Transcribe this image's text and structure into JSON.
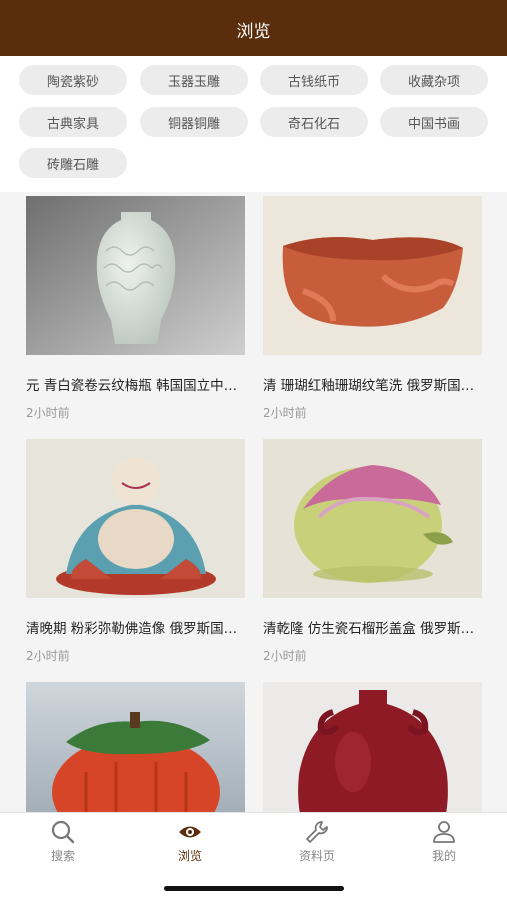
{
  "header": {
    "title": "浏览"
  },
  "categories": [
    "陶瓷紫砂",
    "玉器玉雕",
    "古钱纸币",
    "收藏杂项",
    "古典家具",
    "铜器铜雕",
    "奇石化石",
    "中国书画",
    "砖雕石雕"
  ],
  "items": [
    {
      "title": "元 青白瓷卷云纹梅瓶 韩国国立中央博物馆藏",
      "time": "2小时前"
    },
    {
      "title": "清 珊瑚红釉珊瑚纹笔洗 俄罗斯国立艾尔米塔什博物馆藏",
      "time": "2小时前"
    },
    {
      "title": "清晚期 粉彩弥勒佛造像 俄罗斯国立艾尔米塔什博物馆藏",
      "time": "2小时前"
    },
    {
      "title": "清乾隆 仿生瓷石榴形盖盒 俄罗斯国立艾尔米塔什博物馆藏",
      "time": "2小时前"
    },
    {
      "title": "",
      "time": ""
    },
    {
      "title": "",
      "time": ""
    }
  ],
  "tabbar": {
    "tabs": [
      {
        "label": "搜索",
        "icon": "search-icon"
      },
      {
        "label": "浏览",
        "icon": "eye-icon"
      },
      {
        "label": "资料页",
        "icon": "wrench-icon"
      },
      {
        "label": "我的",
        "icon": "user-icon"
      }
    ],
    "active_color": "#5a2e0c",
    "inactive_color": "#888888"
  },
  "colors": {
    "header_bg": "#5a2e0c",
    "chip_bg": "#ececec"
  }
}
